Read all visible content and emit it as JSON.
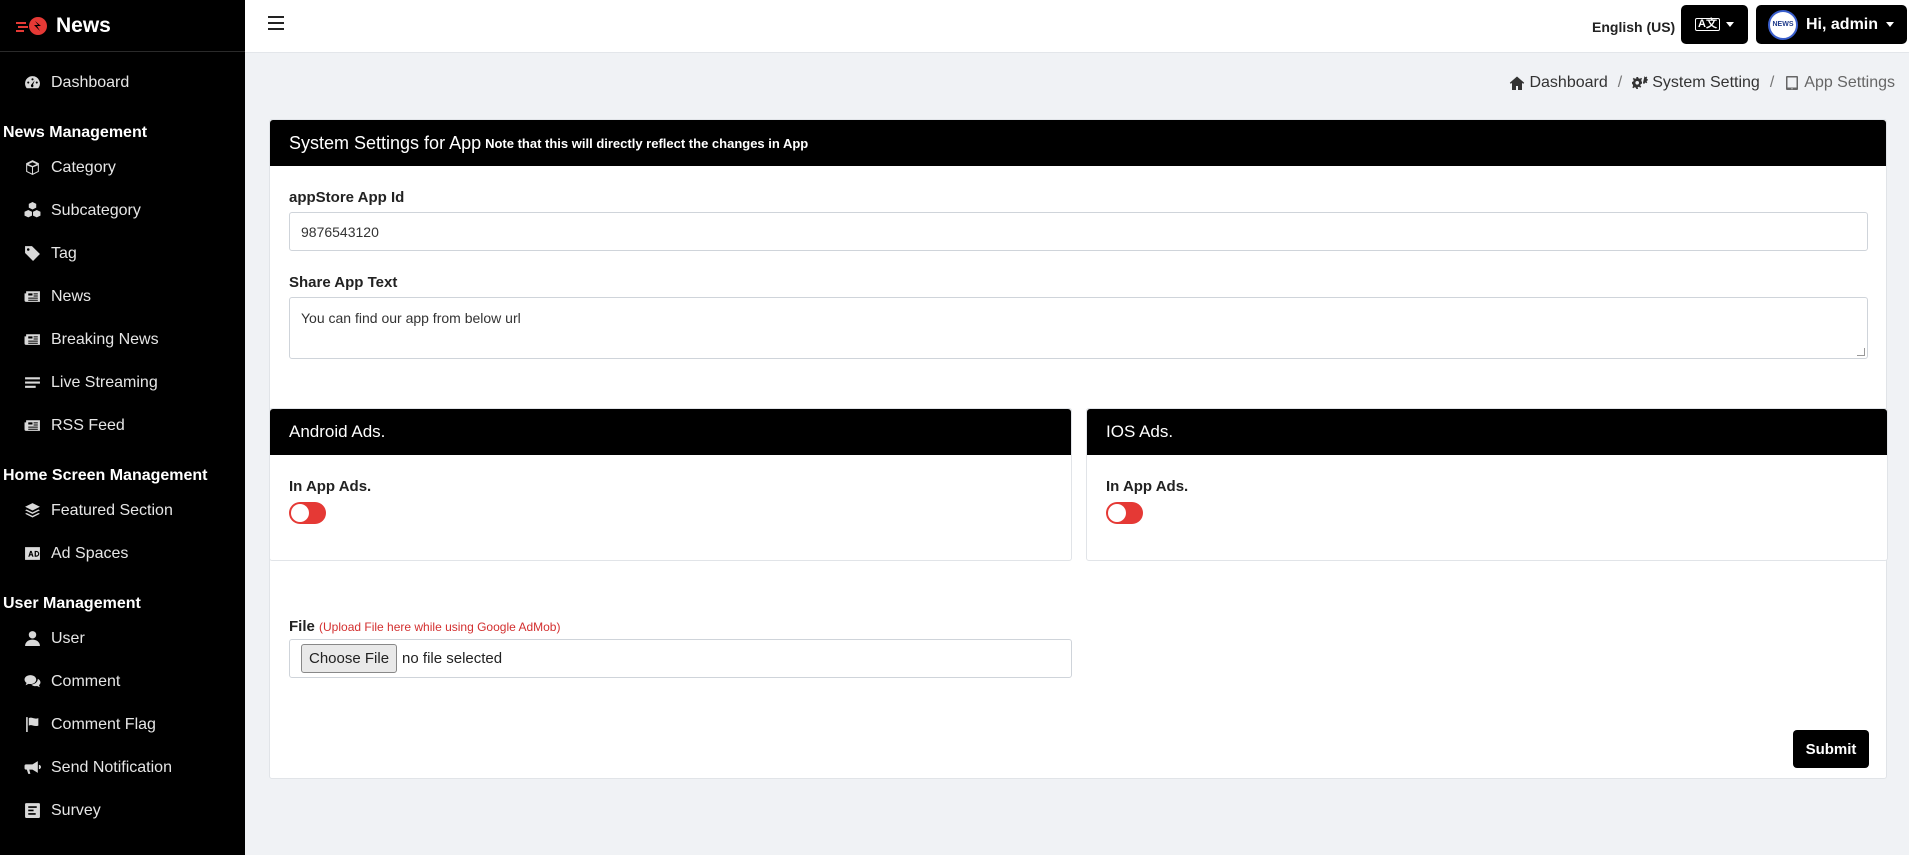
{
  "brand": {
    "name": "News"
  },
  "sidebar": {
    "dashboard": "Dashboard",
    "sections": [
      {
        "title": "News Management",
        "items": [
          "Category",
          "Subcategory",
          "Tag",
          "News",
          "Breaking News",
          "Live Streaming",
          "RSS Feed"
        ]
      },
      {
        "title": "Home Screen Management",
        "items": [
          "Featured Section",
          "Ad Spaces"
        ]
      },
      {
        "title": "User Management",
        "items": [
          "User",
          "Comment",
          "Comment Flag",
          "Send Notification",
          "Survey"
        ]
      }
    ]
  },
  "topbar": {
    "language": "English (US)",
    "user_greeting": "Hi, admin",
    "avatar_text": "NEWS"
  },
  "breadcrumb": {
    "home": "Dashboard",
    "system": "System Setting",
    "current": "App Settings",
    "sep": "/"
  },
  "card": {
    "title": "System Settings for App",
    "note": "Note that this will directly reflect the changes in App",
    "appstore_label": "appStore App Id",
    "appstore_value": "9876543120",
    "share_label": "Share App Text",
    "share_value": "You can find our app from below url"
  },
  "android": {
    "title": "Android Ads.",
    "label": "In App Ads.",
    "enabled": false
  },
  "ios": {
    "title": "IOS Ads.",
    "label": "In App Ads.",
    "enabled": false
  },
  "file": {
    "label": "File",
    "hint": "(Upload File here while using Google AdMob)",
    "button": "Choose File",
    "status": "no file selected"
  },
  "submit_label": "Submit",
  "colors": {
    "sidebar": "#000000",
    "toggle_off": "#e53935",
    "hint": "#d32f2f"
  }
}
